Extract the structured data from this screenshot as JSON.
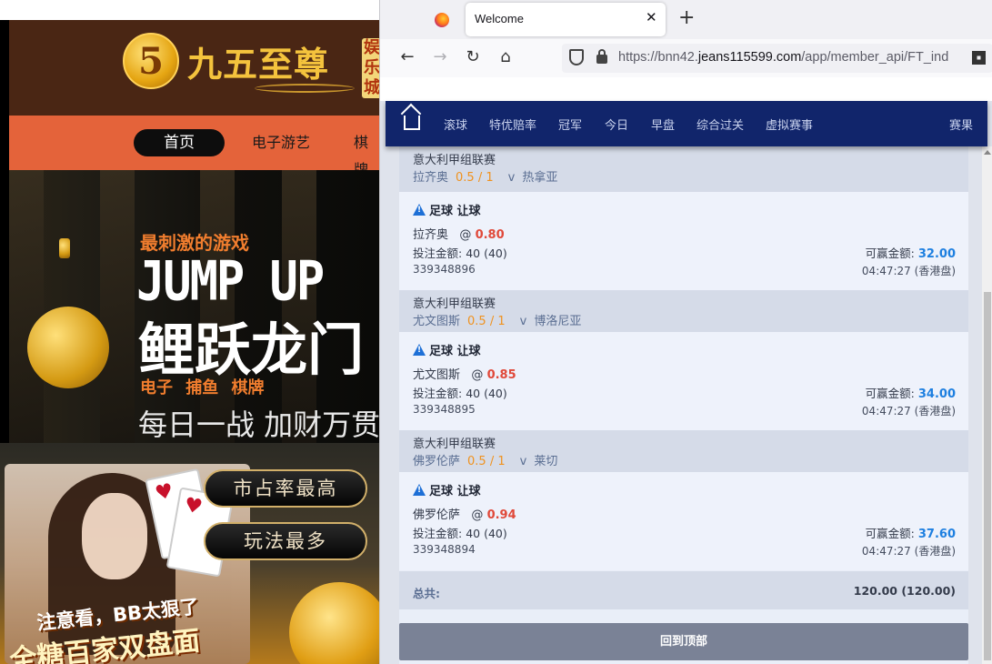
{
  "casino": {
    "logo_mark": "5",
    "logo_text": "九五至尊",
    "logo_side": [
      "娱",
      "乐",
      "城"
    ],
    "nav": [
      "首页",
      "电子游艺",
      "棋牌"
    ],
    "hero_tagline": "最刺激的游戏",
    "hero_title_en": "JUMP UP",
    "hero_title_cn": "鲤跃龙门",
    "hero_categories": "电子 捕鱼 棋牌",
    "hero_slogan": "每日一战 加财万贯",
    "badge_1": "市占率最高",
    "badge_2": "玩法最多",
    "promo_line1": "注意看，BB太狠了",
    "promo_line2": "全糖百家双盘面",
    "card_suit": "♥"
  },
  "browser": {
    "tab_title": "Welcome",
    "tab_close": "✕",
    "new_tab": "+",
    "back": "←",
    "forward": "→",
    "reload": "↻",
    "home": "⌂",
    "url_prefix": "https://bnn42.",
    "url_domain": "jeans115599.com",
    "url_path": "/app/member_api/FT_ind"
  },
  "site_nav": {
    "items": [
      "滚球",
      "特优赔率",
      "冠军",
      "今日",
      "早盘",
      "综合过关",
      "虚拟赛事",
      "赛果"
    ]
  },
  "bets": [
    {
      "league": "意大利甲组联赛",
      "home": "拉齐奥",
      "handicap": "0.5 / 1",
      "vs": "v",
      "away": "热拿亚",
      "type": "足球 让球",
      "pick": "拉齐奥",
      "at": "@",
      "odds": "0.80",
      "stake_label": "投注金额:",
      "stake": "40 (40)",
      "win_label": "可赢金额:",
      "win": "32.00",
      "id": "339348896",
      "time": "04:47:27 (香港盘)"
    },
    {
      "league": "意大利甲组联赛",
      "home": "尤文图斯",
      "handicap": "0.5 / 1",
      "vs": "v",
      "away": "博洛尼亚",
      "type": "足球 让球",
      "pick": "尤文图斯",
      "at": "@",
      "odds": "0.85",
      "stake_label": "投注金额:",
      "stake": "40 (40)",
      "win_label": "可赢金额:",
      "win": "34.00",
      "id": "339348895",
      "time": "04:47:27 (香港盘)"
    },
    {
      "league": "意大利甲组联赛",
      "home": "佛罗伦萨",
      "handicap": "0.5 / 1",
      "vs": "v",
      "away": "莱切",
      "type": "足球 让球",
      "pick": "佛罗伦萨",
      "at": "@",
      "odds": "0.94",
      "stake_label": "投注金额:",
      "stake": "40 (40)",
      "win_label": "可赢金额:",
      "win": "37.60",
      "id": "339348894",
      "time": "04:47:27 (香港盘)"
    }
  ],
  "summary": {
    "total_label": "总共:",
    "total_value": "120.00 (120.00)",
    "back_to_top": "回到顶部"
  },
  "colors": {
    "nav_bg": "#11256b",
    "odds": "#e0493a",
    "win_amount": "#1d7fe0",
    "handicap": "#f0921e"
  }
}
